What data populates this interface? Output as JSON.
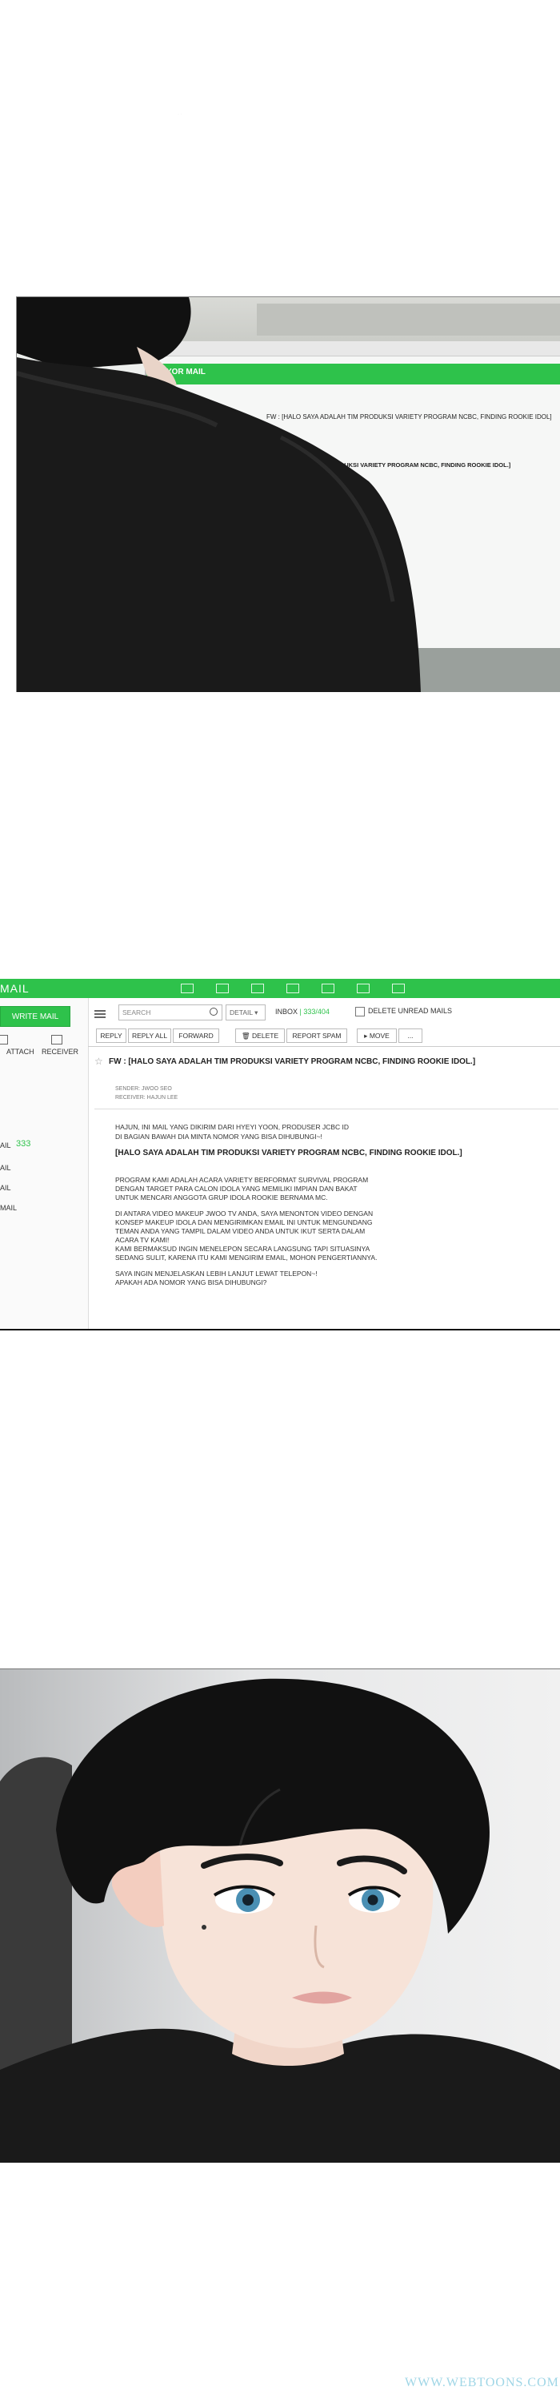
{
  "panel1": {
    "mail_logo": "SAYOR MAIL",
    "email_fw": "FW : [HALO SAYA ADALAH TIM PRODUKSI VARIETY PROGRAM NCBC, FINDING ROOKIE IDOL]",
    "email_title": "[HALO SAYA ADALAH TIM PRODUKSI VARIETY PROGRAM NCBC, FINDING ROOKIE IDOL.]"
  },
  "mail_client": {
    "app_name": "MAIL",
    "sidebar": {
      "write_button": "WRITE MAIL",
      "attach": "ATTACH",
      "receiver": "RECEIVER",
      "folders": [
        "AIL",
        "AIL",
        "AIL",
        "MAIL"
      ],
      "count": "333"
    },
    "toolbar": {
      "search_placeholder": "SEARCH",
      "detail": "DETAIL",
      "inbox": "INBOX",
      "inbox_count": "333/404",
      "delete_unread": "DELETE UNREAD MAILS",
      "reply": "REPLY",
      "reply_all": "REPLY ALL",
      "forward": "FORWARD",
      "delete": "DELETE",
      "report_spam": "REPORT SPAM",
      "move": "MOVE",
      "more": "..."
    },
    "email": {
      "subject": "FW : [HALO SAYA ADALAH TIM PRODUKSI VARIETY PROGRAM NCBC, FINDING ROOKIE IDOL.]",
      "sender": "SENDER: JWOO SEO",
      "receiver": "RECEIVER: HAJUN LEE",
      "intro": [
        "HAJUN, INI MAIL YANG DIKIRIM DARI HYEYI YOON, PRODUSER JCBC ID",
        "DI BAGIAN BAWAH DIA MINTA NOMOR YANG BISA DIHUBUNGI~!"
      ],
      "title": "[HALO SAYA ADALAH TIM PRODUKSI VARIETY PROGRAM NCBC, FINDING ROOKIE IDOL.]",
      "body": [
        "PROGRAM KAMI ADALAH ACARA VARIETY BERFORMAT SURVIVAL PROGRAM",
        "DENGAN TARGET PARA CALON IDOLA YANG MEMILIKI IMPIAN DAN BAKAT",
        "UNTUK MENCARI ANGGOTA GRUP IDOLA ROOKIE BERNAMA MC.",
        "",
        "DI ANTARA VIDEO MAKEUP JWOO TV ANDA, SAYA MENONTON VIDEO DENGAN",
        "KONSEP MAKEUP IDOLA DAN MENGIRIMKAN EMAIL INI UNTUK MENGUNDANG",
        "TEMAN ANDA YANG TAMPIL DALAM VIDEO ANDA UNTUK IKUT SERTA DALAM",
        "ACARA TV KAMI!",
        "KAMI BERMAKSUD INGIN MENELEPON SECARA LANGSUNG TAPI SITUASINYA",
        "SEDANG SULIT, KARENA ITU KAMI MENGIRIM EMAIL, MOHON PENGERTIANNYA.",
        "",
        "SAYA INGIN MENJELASKAN LEBIH LANJUT LEWAT TELEPON~!",
        "APAKAH ADA NOMOR YANG BISA DIHUBUNGI?"
      ]
    }
  },
  "watermark": "WWW.WEBTOONS.COM",
  "colors": {
    "accent": "#2ec24b",
    "hair": "#111111",
    "shirt": "#1a1a1a",
    "skin": "#f7e3d8"
  }
}
